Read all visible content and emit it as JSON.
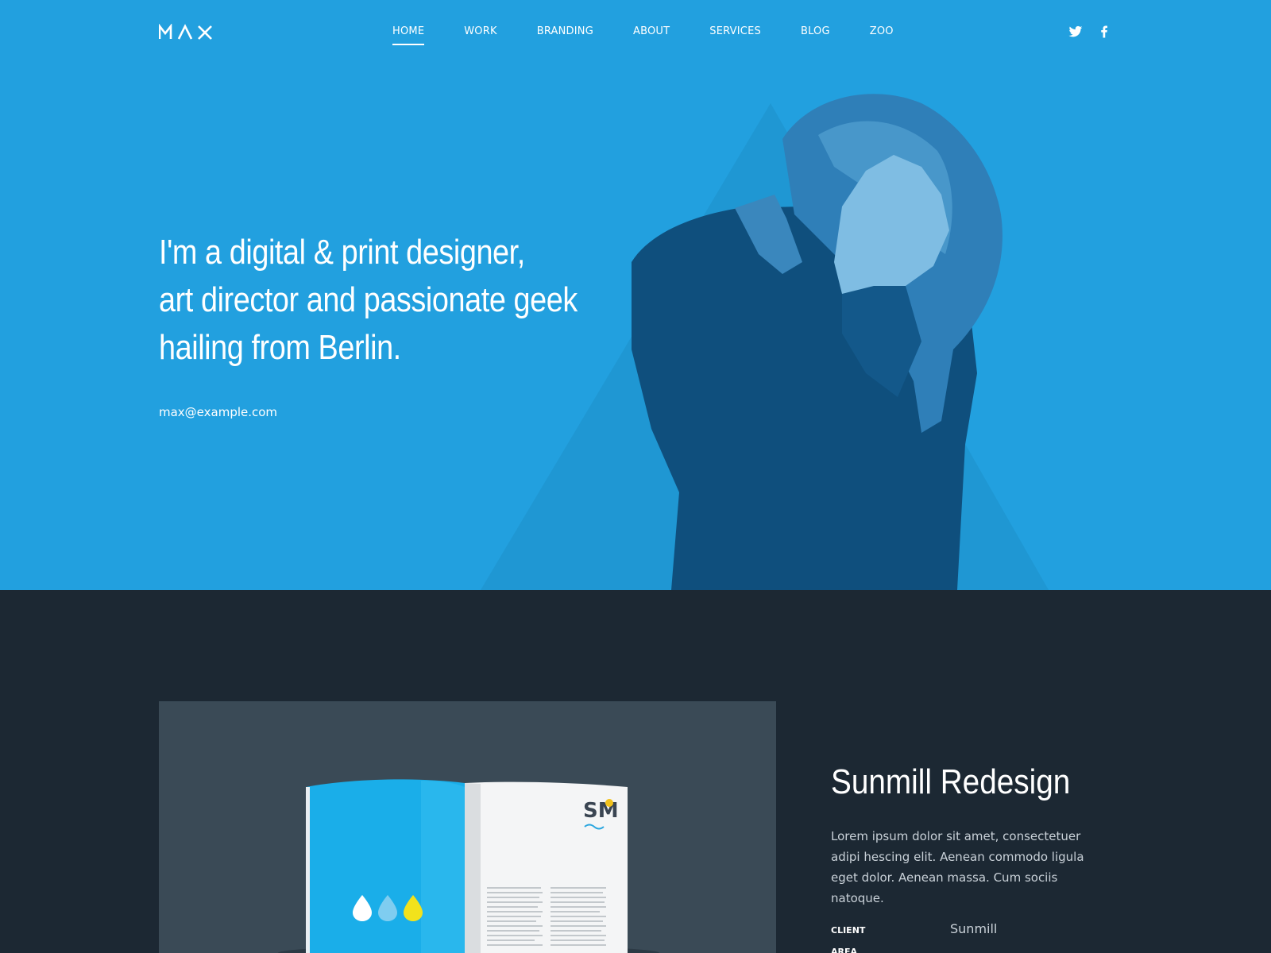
{
  "header": {
    "logo_text": "MAX",
    "nav": [
      {
        "label": "HOME",
        "active": true
      },
      {
        "label": "WORK",
        "active": false
      },
      {
        "label": "BRANDING",
        "active": false
      },
      {
        "label": "ABOUT",
        "active": false
      },
      {
        "label": "SERVICES",
        "active": false
      },
      {
        "label": "BLOG",
        "active": false
      },
      {
        "label": "ZOO",
        "active": false
      }
    ],
    "social": [
      "twitter-icon",
      "facebook-icon"
    ]
  },
  "hero": {
    "headline_lines": [
      "I'm a digital & print designer,",
      "art director and passionate geek",
      "hailing from Berlin."
    ],
    "email": "max@example.com",
    "background_color": "#22a0df"
  },
  "project": {
    "title": "Sunmill Redesign",
    "description": "Lorem ipsum dolor sit amet, consectetuer adipi hescing elit. Aenean commodo ligula eget dolor. Aenean massa. Cum sociis natoque.",
    "meta": [
      {
        "label": "CLIENT",
        "value": "Sunmill"
      },
      {
        "label": "AREA",
        "value": ""
      }
    ],
    "magazine_logo": "SM",
    "background_color": "#1c2833"
  }
}
